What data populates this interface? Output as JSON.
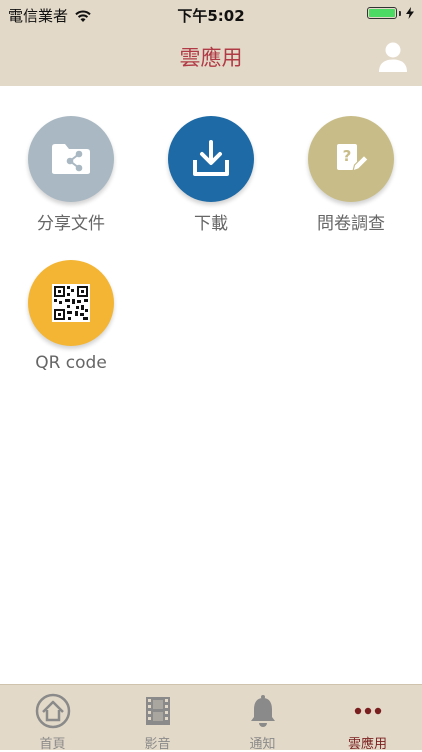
{
  "status_bar": {
    "carrier": "電信業者",
    "time": "下午5:02",
    "battery_level": 1.0,
    "battery_color": "#4cd964"
  },
  "nav": {
    "title": "雲應用",
    "title_color": "#b03a45",
    "profile_icon": "user-icon"
  },
  "apps": [
    {
      "label": "分享文件",
      "icon": "shared-folder-icon",
      "color": "#a9b8c2"
    },
    {
      "label": "下載",
      "icon": "download-icon",
      "color": "#1e6aa6"
    },
    {
      "label": "問卷調查",
      "icon": "survey-icon",
      "color": "#c8bd88"
    },
    {
      "label": "QR code",
      "icon": "qr-code-icon",
      "color": "#f3b533"
    }
  ],
  "tab_bar": {
    "items": [
      {
        "label": "首頁",
        "icon": "home-icon"
      },
      {
        "label": "影音",
        "icon": "film-icon"
      },
      {
        "label": "通知",
        "icon": "bell-icon"
      },
      {
        "label": "雲應用",
        "icon": "more-icon"
      }
    ],
    "active_index": 3,
    "active_color": "#7a1f1f"
  }
}
